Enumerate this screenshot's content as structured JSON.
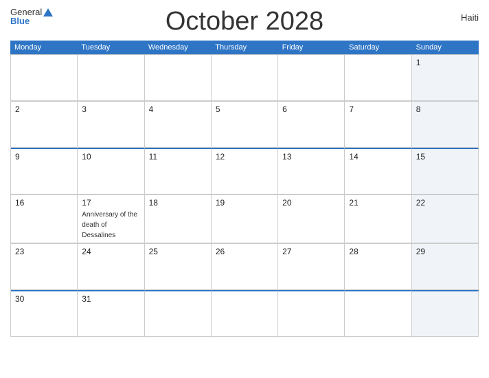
{
  "header": {
    "title": "October 2028",
    "country": "Haiti",
    "logo_general": "General",
    "logo_blue": "Blue"
  },
  "days": {
    "headers": [
      "Monday",
      "Tuesday",
      "Wednesday",
      "Thursday",
      "Friday",
      "Saturday",
      "Sunday"
    ]
  },
  "weeks": [
    {
      "blue_top": false,
      "cells": [
        {
          "day": "",
          "event": "",
          "shaded": false
        },
        {
          "day": "",
          "event": "",
          "shaded": false
        },
        {
          "day": "",
          "event": "",
          "shaded": false
        },
        {
          "day": "",
          "event": "",
          "shaded": false
        },
        {
          "day": "",
          "event": "",
          "shaded": false
        },
        {
          "day": "",
          "event": "",
          "shaded": false
        },
        {
          "day": "1",
          "event": "",
          "shaded": true
        }
      ]
    },
    {
      "blue_top": false,
      "cells": [
        {
          "day": "2",
          "event": "",
          "shaded": false
        },
        {
          "day": "3",
          "event": "",
          "shaded": false
        },
        {
          "day": "4",
          "event": "",
          "shaded": false
        },
        {
          "day": "5",
          "event": "",
          "shaded": false
        },
        {
          "day": "6",
          "event": "",
          "shaded": false
        },
        {
          "day": "7",
          "event": "",
          "shaded": false
        },
        {
          "day": "8",
          "event": "",
          "shaded": true
        }
      ]
    },
    {
      "blue_top": true,
      "cells": [
        {
          "day": "9",
          "event": "",
          "shaded": false
        },
        {
          "day": "10",
          "event": "",
          "shaded": false
        },
        {
          "day": "11",
          "event": "",
          "shaded": false
        },
        {
          "day": "12",
          "event": "",
          "shaded": false
        },
        {
          "day": "13",
          "event": "",
          "shaded": false
        },
        {
          "day": "14",
          "event": "",
          "shaded": false
        },
        {
          "day": "15",
          "event": "",
          "shaded": true
        }
      ]
    },
    {
      "blue_top": false,
      "cells": [
        {
          "day": "16",
          "event": "",
          "shaded": false
        },
        {
          "day": "17",
          "event": "Anniversary of the death of Dessalines",
          "shaded": false
        },
        {
          "day": "18",
          "event": "",
          "shaded": false
        },
        {
          "day": "19",
          "event": "",
          "shaded": false
        },
        {
          "day": "20",
          "event": "",
          "shaded": false
        },
        {
          "day": "21",
          "event": "",
          "shaded": false
        },
        {
          "day": "22",
          "event": "",
          "shaded": true
        }
      ]
    },
    {
      "blue_top": false,
      "cells": [
        {
          "day": "23",
          "event": "",
          "shaded": false
        },
        {
          "day": "24",
          "event": "",
          "shaded": false
        },
        {
          "day": "25",
          "event": "",
          "shaded": false
        },
        {
          "day": "26",
          "event": "",
          "shaded": false
        },
        {
          "day": "27",
          "event": "",
          "shaded": false
        },
        {
          "day": "28",
          "event": "",
          "shaded": false
        },
        {
          "day": "29",
          "event": "",
          "shaded": true
        }
      ]
    },
    {
      "blue_top": true,
      "cells": [
        {
          "day": "30",
          "event": "",
          "shaded": false
        },
        {
          "day": "31",
          "event": "",
          "shaded": false
        },
        {
          "day": "",
          "event": "",
          "shaded": false
        },
        {
          "day": "",
          "event": "",
          "shaded": false
        },
        {
          "day": "",
          "event": "",
          "shaded": false
        },
        {
          "day": "",
          "event": "",
          "shaded": false
        },
        {
          "day": "",
          "event": "",
          "shaded": true
        }
      ]
    }
  ]
}
